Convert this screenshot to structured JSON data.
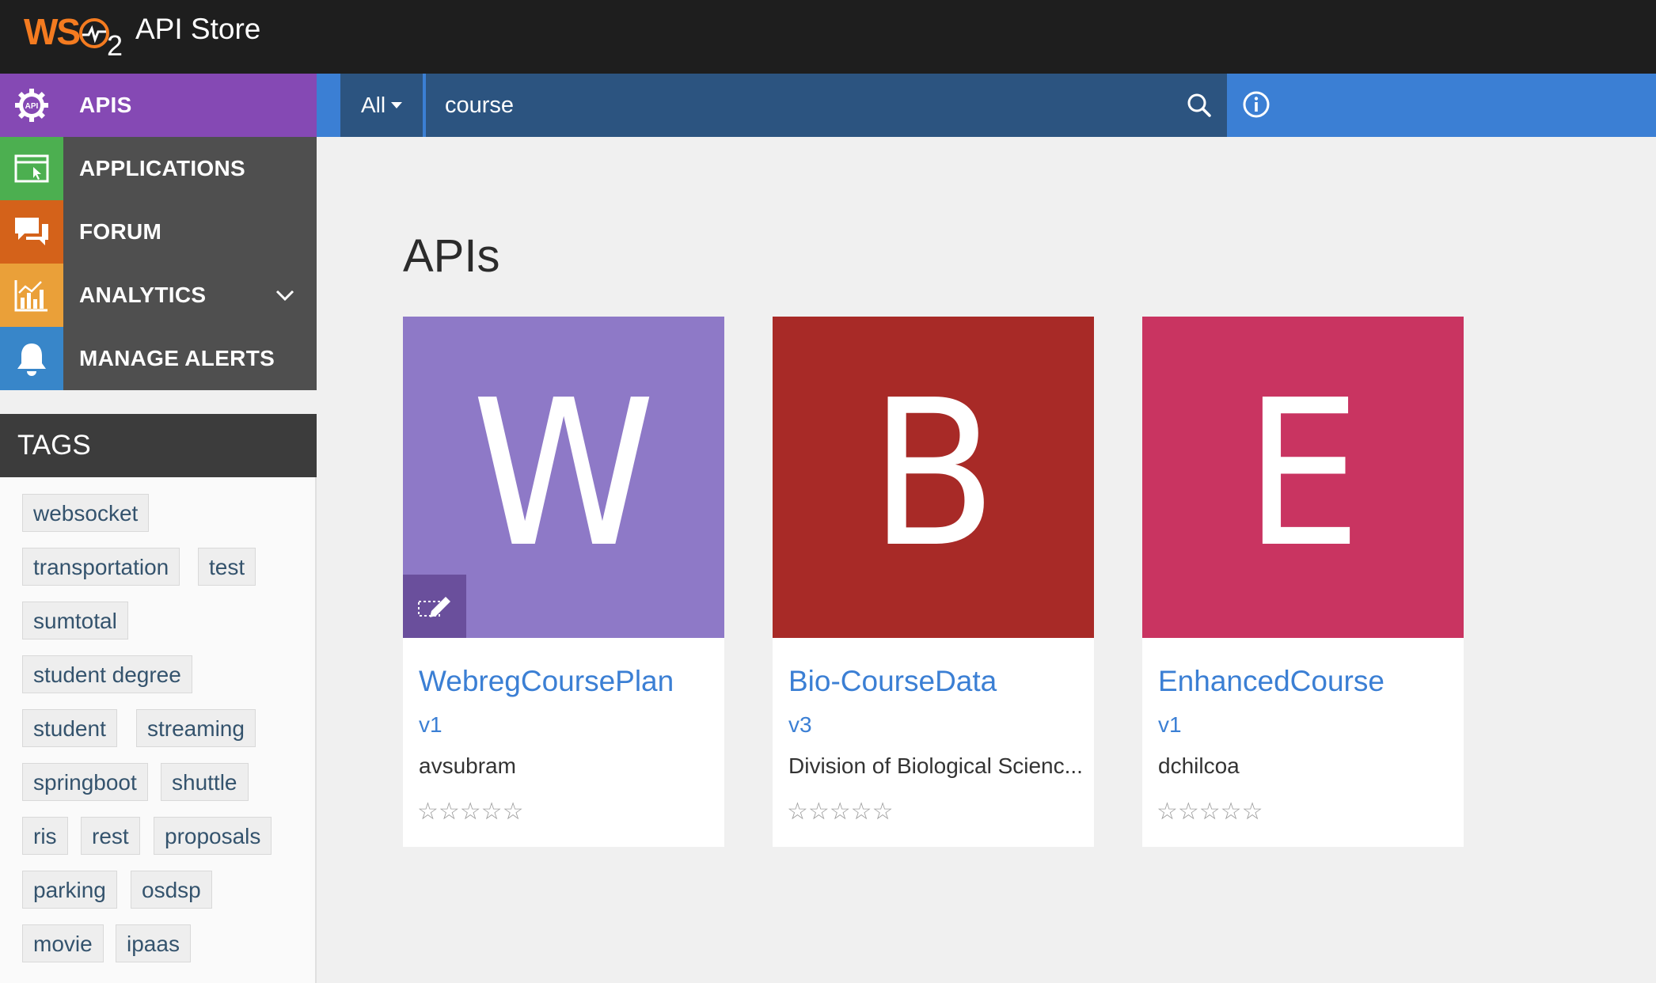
{
  "header": {
    "brand": "WSO2",
    "title": "API Store"
  },
  "sidebar": {
    "items": [
      {
        "label": "APIS",
        "icon": "api-gear-icon",
        "color": "#8549b4"
      },
      {
        "label": "APPLICATIONS",
        "icon": "application-window-icon",
        "color": "#4caf50"
      },
      {
        "label": "FORUM",
        "icon": "chat-bubbles-icon",
        "color": "#d4621a"
      },
      {
        "label": "ANALYTICS",
        "icon": "bar-chart-icon",
        "color": "#eaa039"
      },
      {
        "label": "MANAGE ALERTS",
        "icon": "bell-icon",
        "color": "#3886c9"
      }
    ],
    "analytics_expand_icon": "chevron-down-icon"
  },
  "tags": {
    "title": "TAGS",
    "items": [
      "websocket",
      "transportation",
      "test",
      "sumtotal",
      "student degree",
      "student",
      "streaming",
      "springboot",
      "shuttle",
      "ris",
      "rest",
      "proposals",
      "parking",
      "osdsp",
      "movie",
      "ipaas"
    ]
  },
  "search": {
    "scope": "All",
    "value": "course"
  },
  "main": {
    "title": "APIs",
    "cards": [
      {
        "letter": "W",
        "name": "WebregCoursePlan",
        "version": "v1",
        "owner": "avsubram",
        "rating": "☆☆☆☆☆",
        "color": "#8e79c7"
      },
      {
        "letter": "B",
        "name": "Bio-CourseData",
        "version": "v3",
        "owner": "Division of Biological Scienc...",
        "rating": "☆☆☆☆☆",
        "color": "#a82a27"
      },
      {
        "letter": "E",
        "name": "EnhancedCourse",
        "version": "v1",
        "owner": "dchilcoa",
        "rating": "☆☆☆☆☆",
        "color": "#c93461"
      }
    ]
  }
}
